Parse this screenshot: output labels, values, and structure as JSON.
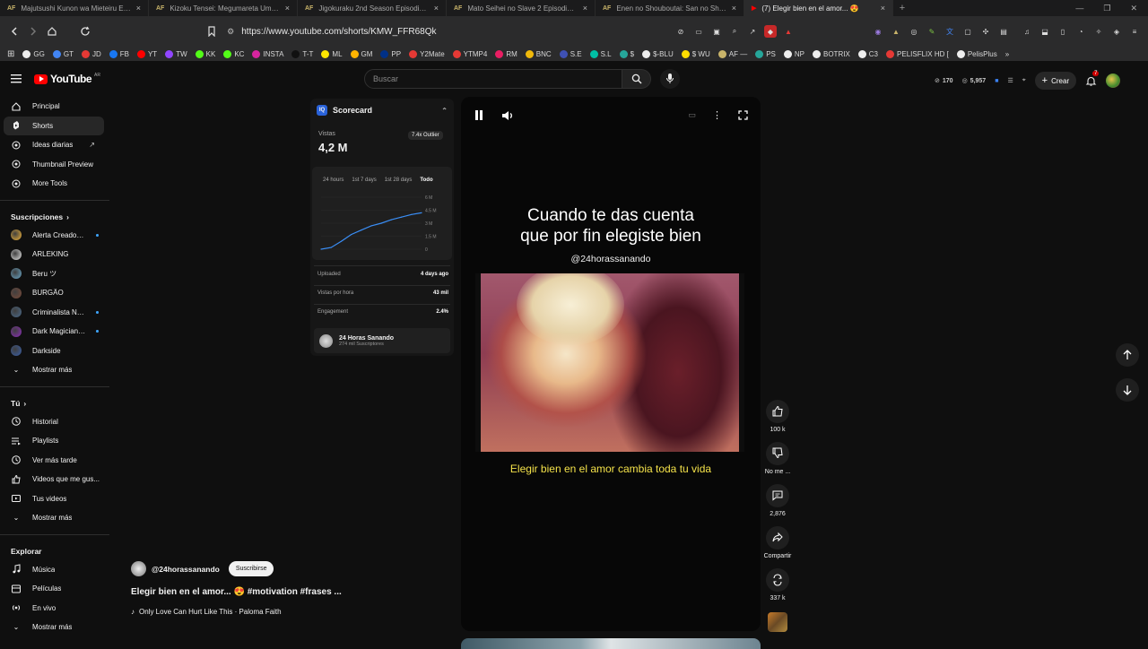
{
  "browser": {
    "tabs": [
      {
        "favicon": "AF",
        "title": "Majutsushi Kunon wa Mieteiru Episo"
      },
      {
        "favicon": "AF",
        "title": "Kizoku Tensei: Megumareta Umare k"
      },
      {
        "favicon": "AF",
        "title": "Jigokuraku 2nd Season Episodio 1 S"
      },
      {
        "favicon": "AF",
        "title": "Mato Seihei no Slave 2 Episodio 1 S"
      },
      {
        "favicon": "AF",
        "title": "Enen no Shouboutai: San no Shou Ep"
      },
      {
        "favicon": "yt",
        "title": "(7) Elegir bien en el amor... 😍",
        "active": true
      }
    ],
    "url": "https://www.youtube.com/shorts/KMW_FFR68Qk",
    "bookmarks": [
      {
        "label": "GG",
        "color": "#eeeeee"
      },
      {
        "label": "GT",
        "color": "#4285f4"
      },
      {
        "label": "JD",
        "color": "#e53935"
      },
      {
        "label": "FB",
        "color": "#1877f2"
      },
      {
        "label": "YT",
        "color": "#ff0000"
      },
      {
        "label": "TW",
        "color": "#9146ff"
      },
      {
        "label": "KK",
        "color": "#53fc18"
      },
      {
        "label": "KC",
        "color": "#53fc18"
      },
      {
        "label": "INSTA",
        "color": "#d6249f"
      },
      {
        "label": "T-T",
        "color": "#111111"
      },
      {
        "label": "ML",
        "color": "#ffe600"
      },
      {
        "label": "GM",
        "color": "#ffb300"
      },
      {
        "label": "PP",
        "color": "#003087"
      },
      {
        "label": "Y2Mate",
        "color": "#e53935"
      },
      {
        "label": "YTMP4",
        "color": "#e53935"
      },
      {
        "label": "RM",
        "color": "#e91e63"
      },
      {
        "label": "BNC",
        "color": "#f0b90b"
      },
      {
        "label": "S.E",
        "color": "#3f51b5"
      },
      {
        "label": "S.L",
        "color": "#00bfa5"
      },
      {
        "label": "$",
        "color": "#26a69a"
      },
      {
        "label": "$-BLU",
        "color": "#eeeeee"
      },
      {
        "label": "$ WU",
        "color": "#ffdd00"
      },
      {
        "label": "AF —",
        "color": "#c9b46a"
      },
      {
        "label": "PS",
        "color": "#26a69a"
      },
      {
        "label": "NP",
        "color": "#eeeeee"
      },
      {
        "label": "BOTRIX",
        "color": "#eeeeee"
      },
      {
        "label": "C3",
        "color": "#eeeeee"
      },
      {
        "label": "PELISFLIX HD [",
        "color": "#e53935"
      },
      {
        "label": "PelisPlus",
        "color": "#eeeeee"
      }
    ]
  },
  "youtube": {
    "logo_text": "YouTube",
    "logo_suffix": "AR",
    "search_placeholder": "Buscar",
    "topbar": {
      "stat1": "170",
      "stat2": "5,957",
      "create_label": "Crear",
      "notif_count": "7"
    },
    "sidebar": {
      "main": [
        {
          "label": "Principal",
          "icon": "home-icon"
        },
        {
          "label": "Shorts",
          "icon": "shorts-icon",
          "active": true
        },
        {
          "label": "Ideas diarias",
          "icon": "ideas-icon"
        },
        {
          "label": "Thumbnail Preview",
          "icon": "thumbnail-icon"
        },
        {
          "label": "More Tools",
          "icon": "tools-icon"
        }
      ],
      "subs_title": "Suscripciones",
      "subs": [
        {
          "label": "Alerta Creadores",
          "color": "#f2b53a",
          "dot": true
        },
        {
          "label": "ARLEKING",
          "color": "#e8e8e8"
        },
        {
          "label": "Beru ツ",
          "color": "#6aa8c9"
        },
        {
          "label": "BURGÃO",
          "color": "#7a4b3a"
        },
        {
          "label": "Criminalista Noc...",
          "color": "#4b6a8a",
          "dot": true
        },
        {
          "label": "Dark Magician S...",
          "color": "#8e2dbb",
          "dot": true
        },
        {
          "label": "Darkside",
          "color": "#3a5fa8"
        }
      ],
      "subs_more": "Mostrar más",
      "you_title": "Tú",
      "you": [
        {
          "label": "Historial",
          "icon": "history-icon"
        },
        {
          "label": "Playlists",
          "icon": "playlists-icon"
        },
        {
          "label": "Ver más tarde",
          "icon": "watch-later-icon"
        },
        {
          "label": "Videos que me gus...",
          "icon": "liked-icon"
        },
        {
          "label": "Tus videos",
          "icon": "your-videos-icon"
        }
      ],
      "you_more": "Mostrar más",
      "explore_title": "Explorar",
      "explore": [
        {
          "label": "Música",
          "icon": "music-icon"
        },
        {
          "label": "Películas",
          "icon": "movies-icon"
        },
        {
          "label": "En vivo",
          "icon": "live-icon"
        }
      ],
      "explore_more": "Mostrar más"
    },
    "scorecard": {
      "title": "Scorecard",
      "views_label": "Vistas",
      "views_value": "4,2 M",
      "outlier": "7.4x Outlier",
      "ranges": [
        "24 hours",
        "1st 7 days",
        "1st 28 days",
        "Todo"
      ],
      "rows": [
        {
          "label": "Uploaded",
          "value": "4 days ago"
        },
        {
          "label": "Vistas por hora",
          "value": "43 mil"
        },
        {
          "label": "Engagement",
          "value": "2.4%"
        }
      ],
      "channel_name": "24 Horas Sanando",
      "channel_subs": "274 mil Suscriptores"
    },
    "chart_data": {
      "type": "line",
      "title": "",
      "xlabel": "",
      "ylabel": "",
      "y_ticks": [
        "6 M",
        "4.5 M",
        "3 M",
        "1.5 M",
        "0"
      ],
      "ylim": [
        0,
        6000000
      ],
      "x": [
        0,
        1,
        2,
        3,
        4,
        5,
        6,
        7,
        8,
        9,
        10
      ],
      "series": [
        {
          "values": [
            0,
            200000,
            900000,
            1700000,
            2200000,
            2700000,
            3000000,
            3400000,
            3700000,
            4000000,
            4200000
          ]
        }
      ],
      "grid": true
    },
    "video": {
      "title_line1": "Cuando te das cuenta",
      "title_line2": "que por fin elegiste bien",
      "handle": "@24horassanando",
      "caption": "Elegir bien en el amor cambia toda tu vida"
    },
    "actions": [
      {
        "name": "like",
        "label": "100 k"
      },
      {
        "name": "dislike",
        "label": "No me ..."
      },
      {
        "name": "comments",
        "label": "2,876"
      },
      {
        "name": "share",
        "label": "Compartir"
      },
      {
        "name": "remix",
        "label": "337 k"
      }
    ],
    "bottom": {
      "channel": "@24horassanando",
      "subscribe": "Suscribirse",
      "title": "Elegir bien en el amor... 😍 #motivation #frases ...",
      "song": "Only Love Can Hurt Like This · Paloma Faith"
    }
  }
}
